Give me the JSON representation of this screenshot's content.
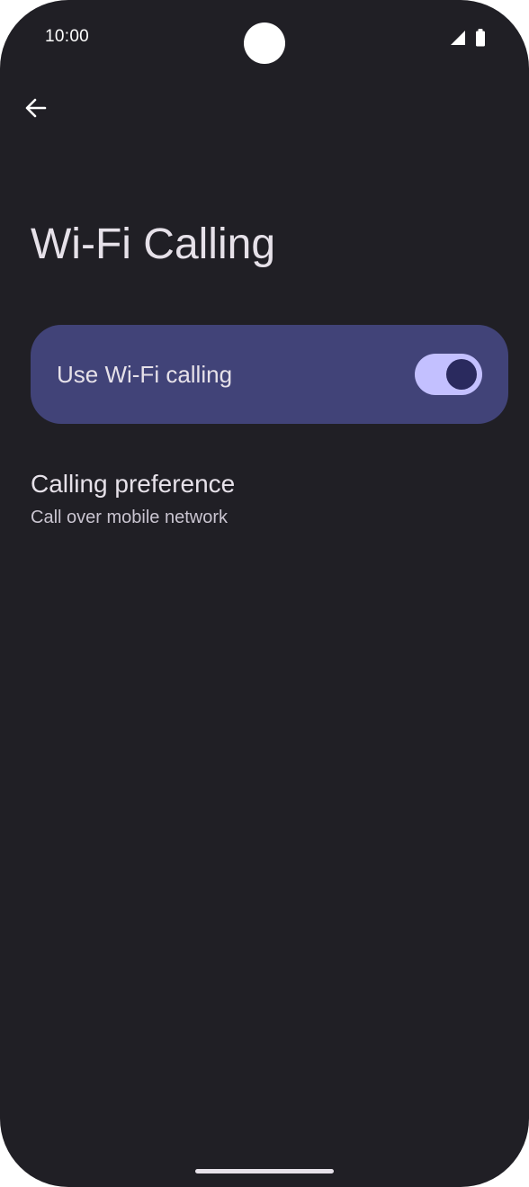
{
  "status_bar": {
    "time": "10:00",
    "icons": [
      "signal-icon",
      "battery-icon"
    ]
  },
  "toolbar": {
    "back_icon": "arrow-back-icon"
  },
  "page": {
    "title": "Wi-Fi Calling"
  },
  "wifi_calling_toggle": {
    "label": "Use Wi-Fi calling",
    "checked": true
  },
  "calling_preference": {
    "title": "Calling preference",
    "summary": "Call over mobile network"
  },
  "colors": {
    "background": "#201f25",
    "card": "#414378",
    "switch_track": "#c3c0ff",
    "switch_thumb": "#2a2a5e",
    "text_primary": "#e6e1e9",
    "text_secondary": "#c9c4d0"
  }
}
